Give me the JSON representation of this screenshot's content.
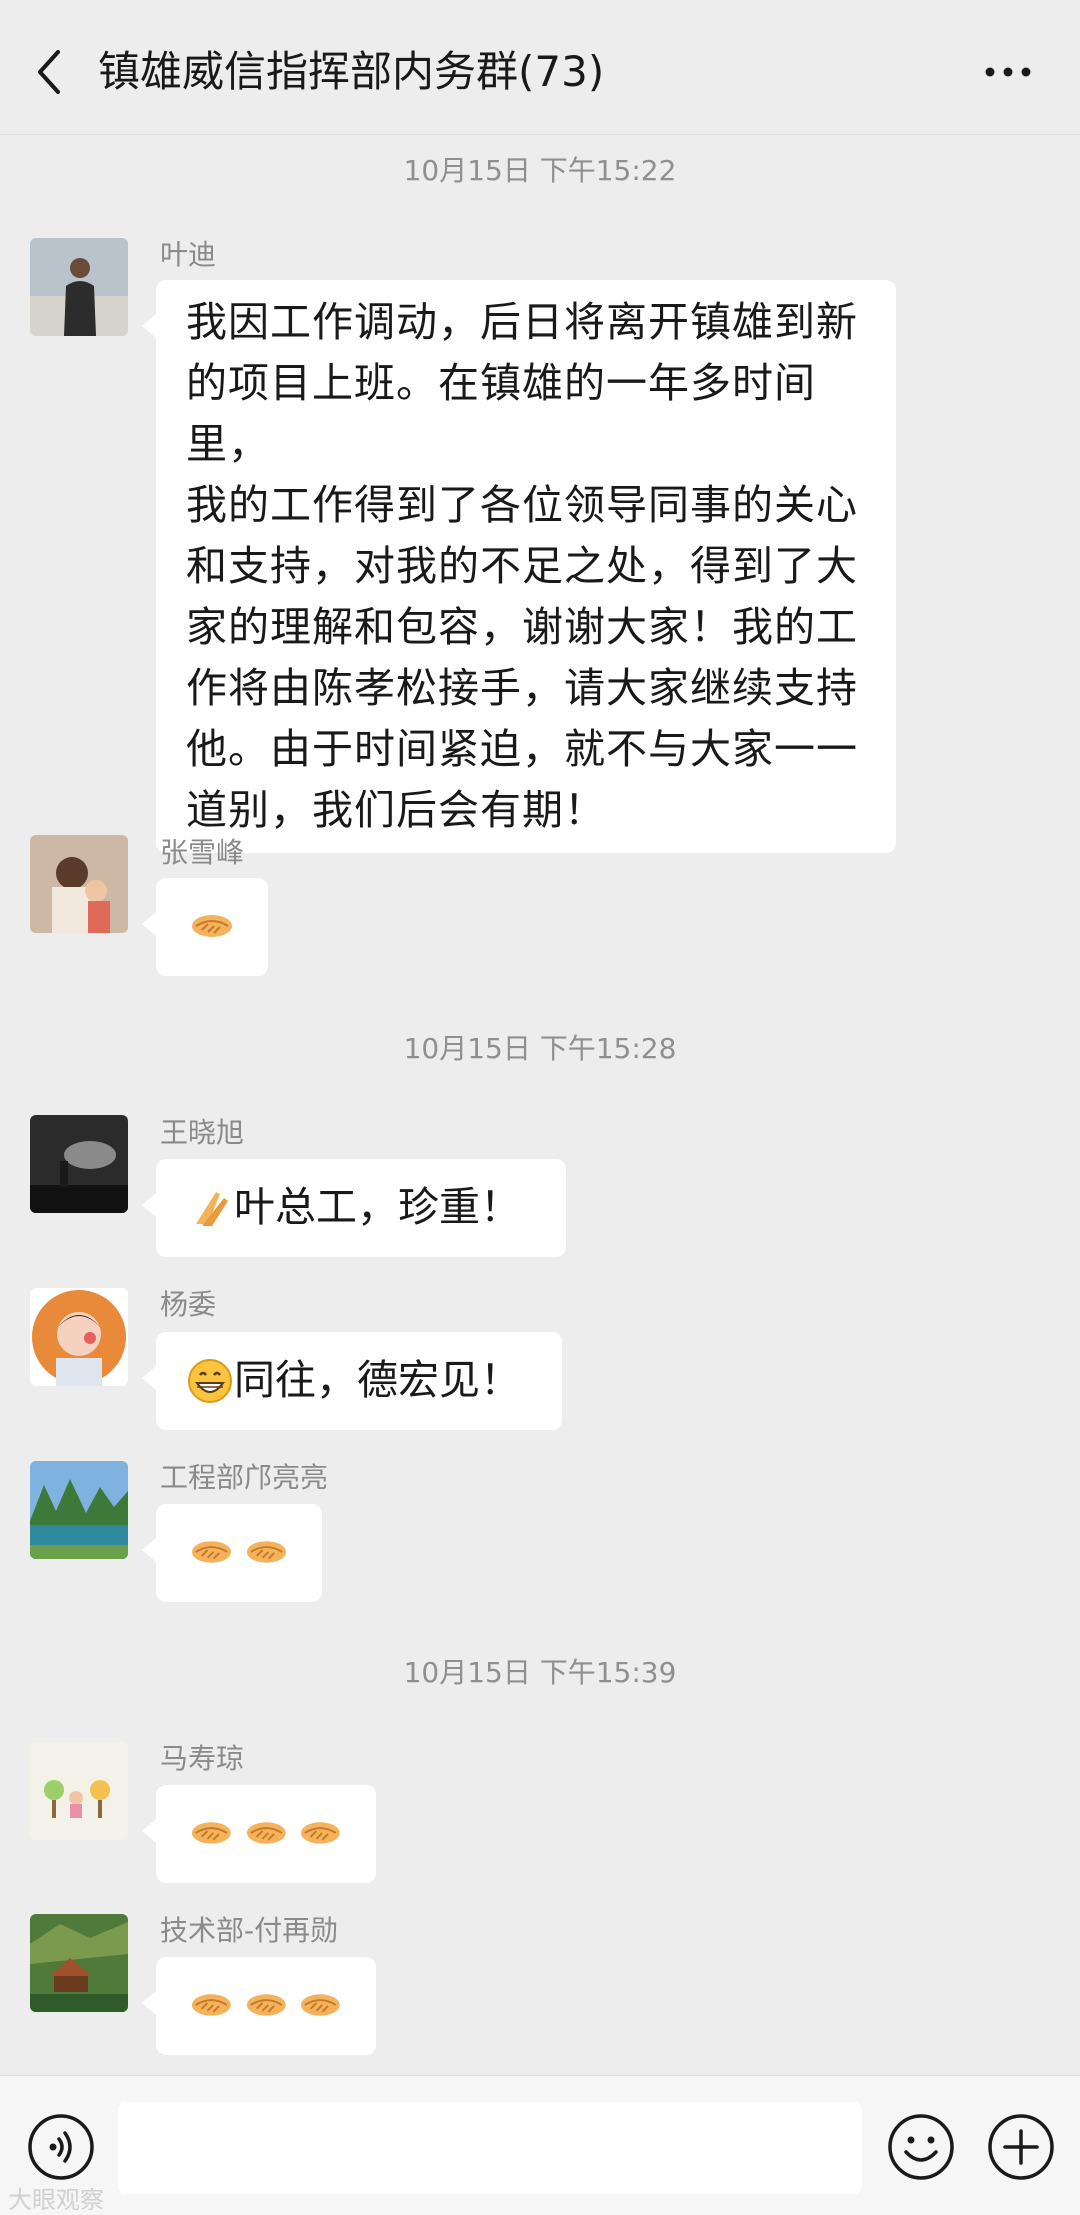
{
  "header": {
    "title": "镇雄威信指挥部内务群(73)",
    "back_icon": "chevron-left-icon",
    "more_icon": "more-dots-icon"
  },
  "timestamps": [
    "10月15日 下午15:22",
    "10月15日 下午15:28",
    "10月15日 下午15:39"
  ],
  "messages": [
    {
      "sender": "叶迪",
      "lines": [
        "我因工作调动，后日将离开镇雄到新",
        "的项目上班。在镇雄的一年多时间里，",
        "我的工作得到了各位领导同事的关心",
        "和支持，对我的不足之处，得到了大",
        "家的理解和包容，谢谢大家！我的工",
        "作将由陈孝松接手，请大家继续支持",
        "他。由于时间紧迫，就不与大家一一",
        "道别，我们后会有期！"
      ]
    },
    {
      "sender": "张雪峰",
      "emojis": [
        "handshake"
      ]
    },
    {
      "sender": "王晓旭",
      "emoji": "praying-hands",
      "text": "叶总工，珍重！"
    },
    {
      "sender": "杨委",
      "emoji": "grin",
      "text": "同往，德宏见！"
    },
    {
      "sender": "工程部邝亮亮",
      "emojis": [
        "handshake",
        "handshake"
      ]
    },
    {
      "sender": "马寿琼",
      "emojis": [
        "handshake",
        "handshake",
        "handshake"
      ]
    },
    {
      "sender": "技术部-付再勋",
      "emojis": [
        "handshake",
        "handshake",
        "handshake"
      ]
    }
  ],
  "input_bar": {
    "voice_icon": "voice-icon",
    "emoji_icon": "smiley-icon",
    "plus_icon": "plus-circle-icon",
    "input_value": ""
  },
  "watermark": "大眼观察",
  "colors": {
    "background": "#ededed",
    "bubble": "#ffffff",
    "timestamp": "#8f8f8f",
    "sender": "#8a8a8a"
  }
}
